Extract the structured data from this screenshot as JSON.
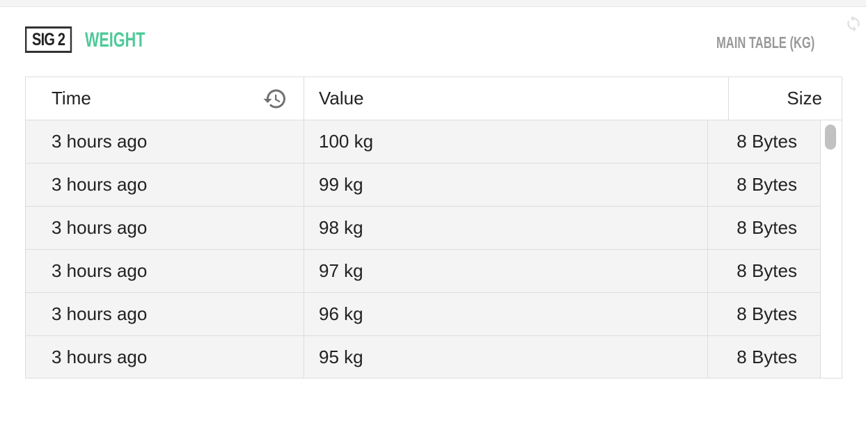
{
  "widget": {
    "signal_badge": "SIG 2",
    "signal_name": "WEIGHT",
    "table_title": "MAIN TABLE (KG)",
    "accent_color": "#4fc99a",
    "refresh_icon": "refresh-icon",
    "history_icon": "history-icon"
  },
  "table": {
    "columns": [
      "Time",
      "Value",
      "Size"
    ],
    "rows": [
      {
        "time": "3 hours ago",
        "value": "100 kg",
        "size": "8 Bytes"
      },
      {
        "time": "3 hours ago",
        "value": "99 kg",
        "size": "8 Bytes"
      },
      {
        "time": "3 hours ago",
        "value": "98 kg",
        "size": "8 Bytes"
      },
      {
        "time": "3 hours ago",
        "value": "97 kg",
        "size": "8 Bytes"
      },
      {
        "time": "3 hours ago",
        "value": "96 kg",
        "size": "8 Bytes"
      },
      {
        "time": "3 hours ago",
        "value": "95 kg",
        "size": "8 Bytes"
      }
    ]
  }
}
